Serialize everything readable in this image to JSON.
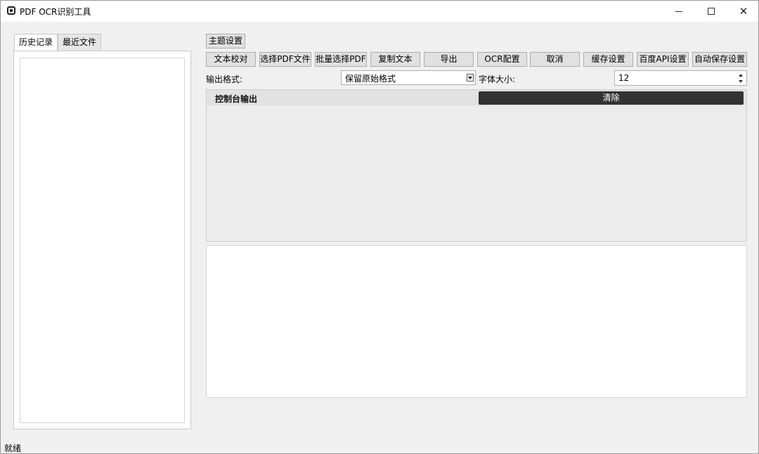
{
  "window": {
    "title": "PDF OCR识别工具"
  },
  "left_panel": {
    "tabs": [
      {
        "label": "历史记录",
        "active": true
      },
      {
        "label": "最近文件",
        "active": false
      }
    ]
  },
  "toolbar": {
    "theme_button": "主题设置",
    "buttons": [
      "文本校对",
      "选择PDF文件",
      "批量选择PDF",
      "复制文本",
      "导出",
      "OCR配置",
      "取消",
      "缓存设置",
      "百度API设置",
      "自动保存设置"
    ]
  },
  "options": {
    "output_format_label": "输出格式:",
    "output_format_value": "保留原始格式",
    "font_size_label": "字体大小:",
    "font_size_value": "12"
  },
  "console": {
    "title": "控制台输出",
    "clear_label": "清除"
  },
  "status": {
    "text": "就绪"
  },
  "colors": {
    "clear_button_bg": "#333333",
    "window_bg": "#f0f0f0"
  }
}
